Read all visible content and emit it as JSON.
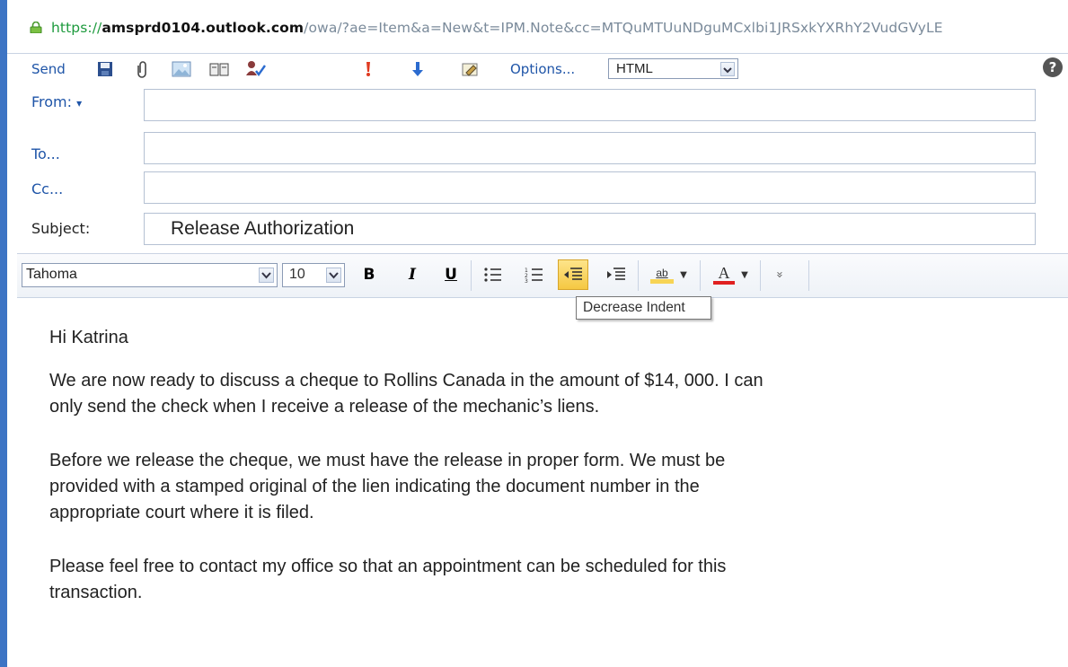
{
  "address_bar": {
    "url_scheme": "https://",
    "url_host": "amsprd0104.outlook.com",
    "url_path": "/owa/?ae=Item&a=New&t=IPM.Note&cc=MTQuMTUuNDguMCxlbi1JRSxkYXRhY2VudGVyLE"
  },
  "toolbar": {
    "send_label": "Send",
    "options_label": "Options...",
    "format_value": "HTML",
    "help_label": "?"
  },
  "headers": {
    "from_label": "From:",
    "from_arrow": "▾",
    "to_label": "To...",
    "cc_label": "Cc...",
    "subject_label": "Subject:",
    "subject_value": "Release Authorization"
  },
  "format_bar": {
    "font_name": "Tahoma",
    "font_size": "10",
    "bold_label": "B",
    "italic_label": "I",
    "underline_label": "U",
    "highlight_label": "ab",
    "font_color_label": "A",
    "more_label": "»",
    "tooltip": "Decrease Indent"
  },
  "body": {
    "greeting": "Hi Katrina",
    "para1_line1": "We are now ready to discuss a cheque to Rollins Canada in the amount of $14, 000.  I can",
    "para1_line2": "only send the check when I receive a release of the mechanic’s liens.",
    "para2_line1": "Before we release the cheque, we must have the release in proper form.  We must be",
    "para2_line2": "provided with a stamped original of the lien indicating the document number in the",
    "para2_line3": "appropriate court where it is filed.",
    "para3_line1": "Please feel free to contact my office so that an appointment can be scheduled for this",
    "para3_line2": "transaction."
  },
  "colors": {
    "frame_blue": "#3d74c4",
    "link_blue": "#1f55a8",
    "secure_green": "#1d9a3d",
    "highlight_yellow": "#f7d454",
    "font_color_red": "#e02020"
  }
}
